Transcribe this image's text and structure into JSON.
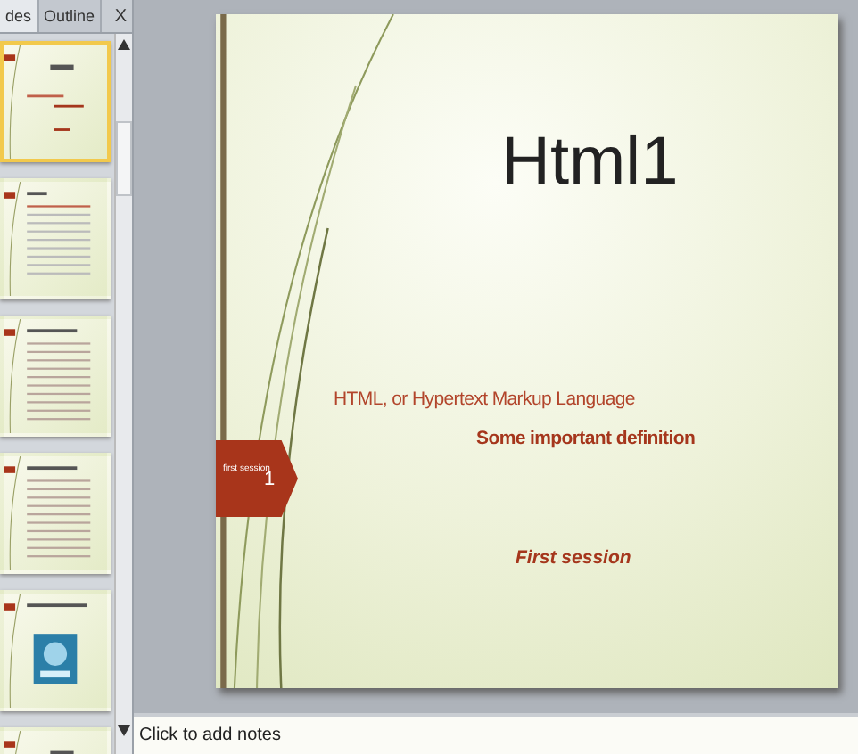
{
  "panel_tabs": [
    {
      "label": "des",
      "selected": true
    },
    {
      "label": "Outline",
      "selected": false
    }
  ],
  "panel_close": "X",
  "thumbnails": [
    {
      "kind": "title",
      "selected": true
    },
    {
      "kind": "list",
      "selected": false
    },
    {
      "kind": "text",
      "selected": false
    },
    {
      "kind": "text",
      "selected": false
    },
    {
      "kind": "picture",
      "selected": false
    },
    {
      "kind": "title",
      "selected": false
    }
  ],
  "slide": {
    "title": "Html1",
    "subtitle": "HTML, or Hypertext Markup Language",
    "heading": "Some important definition",
    "tag_label": "first session",
    "tag_number": "1",
    "footer": "First session"
  },
  "notes": {
    "placeholder": "Click to add notes"
  }
}
